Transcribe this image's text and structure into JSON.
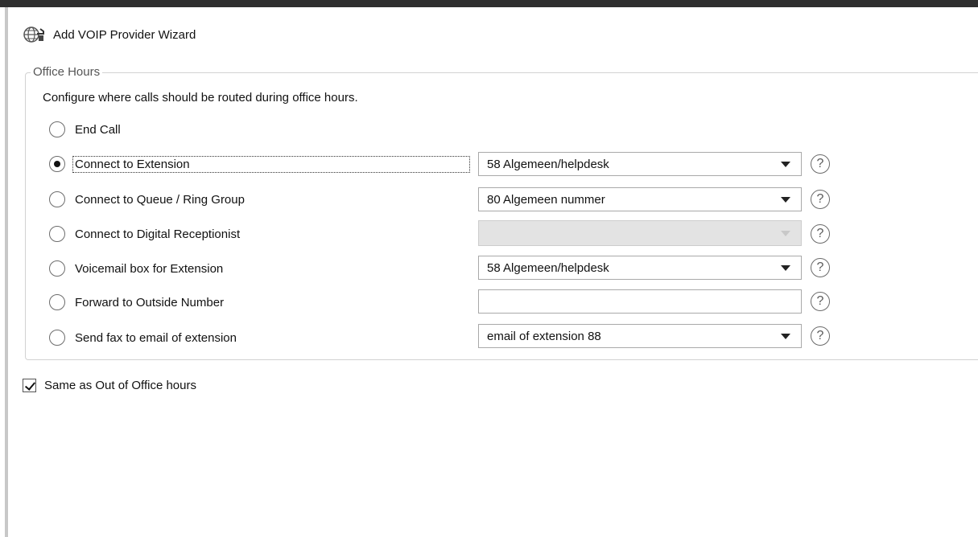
{
  "window": {
    "title": "Add VOIP Provider Wizard",
    "title_icon": "globe-phone-icon"
  },
  "office_hours": {
    "legend": "Office Hours",
    "description": "Configure where calls should be routed during office hours.",
    "options": [
      {
        "label": "End Call",
        "selected": false
      },
      {
        "label": "Connect to Extension",
        "selected": true,
        "value": "58 Algemeen/helpdesk"
      },
      {
        "label": "Connect to Queue / Ring Group",
        "selected": false,
        "value": "80 Algemeen nummer"
      },
      {
        "label": "Connect to Digital Receptionist",
        "selected": false,
        "value": "",
        "disabled": true
      },
      {
        "label": "Voicemail box for Extension",
        "selected": false,
        "value": "58 Algemeen/helpdesk"
      },
      {
        "label": "Forward to Outside Number",
        "selected": false,
        "value": ""
      },
      {
        "label": "Send fax to email of extension",
        "selected": false,
        "value": "email of extension 88"
      }
    ],
    "help_glyph": "?"
  },
  "same_as_out_of_office": {
    "label": "Same as Out of Office hours",
    "checked": true
  }
}
